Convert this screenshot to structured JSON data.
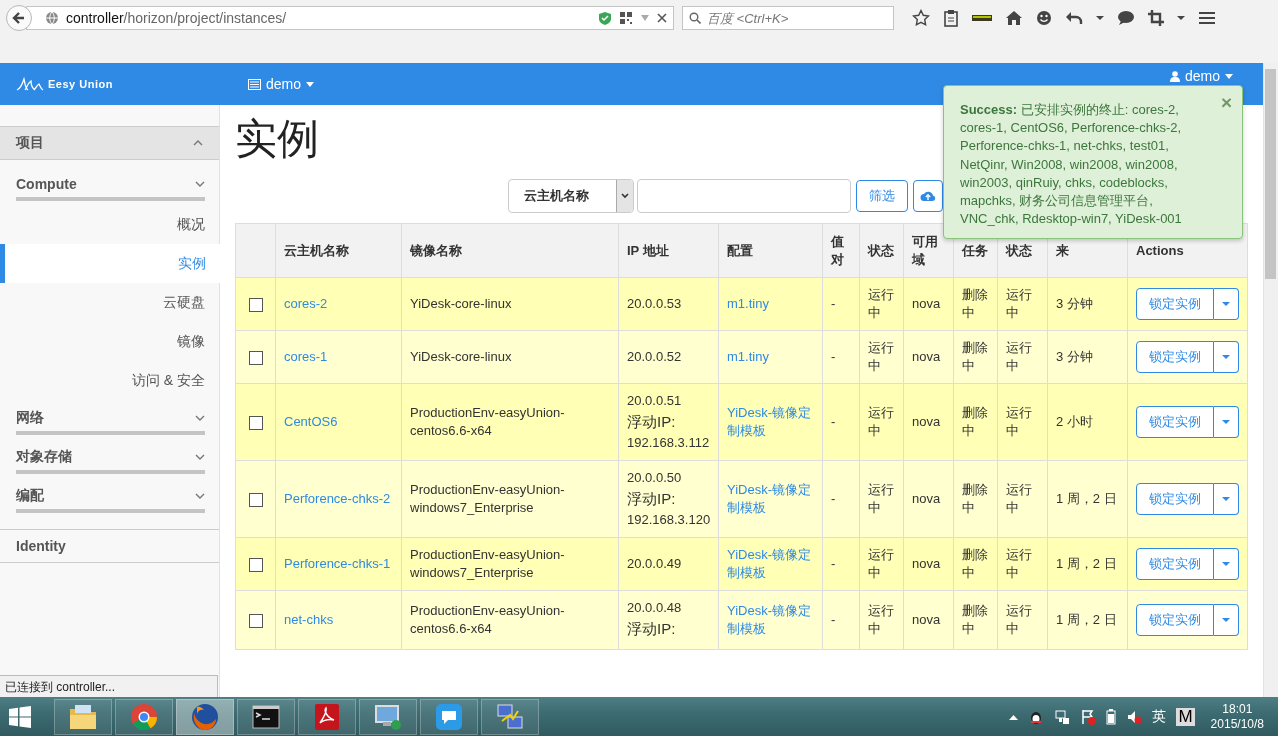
{
  "browser": {
    "url_host": "controller",
    "url_path": "/horizon/project/instances/",
    "search_placeholder": "百度 <Ctrl+K>"
  },
  "navbar": {
    "brand": "Eesy Union",
    "project": "demo",
    "user": "demo"
  },
  "sidebar": [
    {
      "label": "项目",
      "expanded": true,
      "children": [
        {
          "label": "Compute",
          "children": [
            {
              "label": "概况",
              "selected": false
            },
            {
              "label": "实例",
              "selected": true
            },
            {
              "label": "云硬盘",
              "selected": false
            },
            {
              "label": "镜像",
              "selected": false
            },
            {
              "label": "访问 & 安全",
              "selected": false
            }
          ]
        },
        {
          "label": "网络"
        },
        {
          "label": "对象存储"
        },
        {
          "label": "编配"
        }
      ]
    },
    {
      "label": "Identity",
      "expanded": false
    }
  ],
  "page_title": "实例",
  "filter": {
    "field": "云主机名称",
    "button": "筛选"
  },
  "table": {
    "columns": [
      "云主机名称",
      "镜像名称",
      "IP 地址",
      "配置",
      "值对",
      "状态",
      "可用域",
      "任务",
      "状态",
      "来",
      "Actions"
    ],
    "rows": [
      {
        "checked": false,
        "name": "cores-2",
        "image": "YiDesk-core-linux",
        "ip": "20.0.0.53",
        "config": "m1.tiny",
        "keypair": "-",
        "status": "运行中",
        "zone": "nova",
        "task": "删除中",
        "power": "运行中",
        "age": "3 分钟",
        "action": "锁定实例"
      },
      {
        "checked": false,
        "name": "cores-1",
        "image": "YiDesk-core-linux",
        "ip": "20.0.0.52",
        "config": "m1.tiny",
        "keypair": "-",
        "status": "运行中",
        "zone": "nova",
        "task": "删除中",
        "power": "运行中",
        "age": "3 分钟",
        "action": "锁定实例"
      },
      {
        "checked": false,
        "name": "CentOS6",
        "image": "ProductionEnv-easyUnion-centos6.6-x64",
        "ip": "20.0.0.51",
        "floating_label": "浮动IP:",
        "floating_ip": "192.168.3.112",
        "config": "YiDesk-镜像定制模板",
        "keypair": "-",
        "status": "运行中",
        "zone": "nova",
        "task": "删除中",
        "power": "运行中",
        "age": "2 小时",
        "action": "锁定实例"
      },
      {
        "checked": false,
        "name": "Perforence-chks-2",
        "image": "ProductionEnv-easyUnion-windows7_Enterprise",
        "ip": "20.0.0.50",
        "floating_label": "浮动IP:",
        "floating_ip": "192.168.3.120",
        "config": "YiDesk-镜像定制模板",
        "keypair": "-",
        "status": "运行中",
        "zone": "nova",
        "task": "删除中",
        "power": "运行中",
        "age": "1 周，2 日",
        "action": "锁定实例"
      },
      {
        "checked": false,
        "name": "Perforence-chks-1",
        "image": "ProductionEnv-easyUnion-windows7_Enterprise",
        "ip": "20.0.0.49",
        "config": "YiDesk-镜像定制模板",
        "keypair": "-",
        "status": "运行中",
        "zone": "nova",
        "task": "删除中",
        "power": "运行中",
        "age": "1 周，2 日",
        "action": "锁定实例"
      },
      {
        "checked": false,
        "name": "net-chks",
        "image": "ProductionEnv-easyUnion-centos6.6-x64",
        "ip": "20.0.0.48",
        "floating_label": "浮动IP:",
        "config": "YiDesk-镜像定制模板",
        "keypair": "-",
        "status": "运行中",
        "zone": "nova",
        "task": "删除中",
        "power": "运行中",
        "age": "1 周，2 日",
        "action": "锁定实例"
      }
    ]
  },
  "toast": {
    "message": "**Success:** 已安排实例的终止: cores-2, cores-1, CentOS6, Perforence-chks-2, Perforence-chks-1, net-chks, test01, NetQinr, Win2008, win2008, win2008, win2003, qinRuiy, chks, codeblocks, mapchks, 财务公司信息管理平台, VNC_chk, Rdesktop-win7, YiDesk-001",
    "close": "×"
  },
  "status_tooltip": "已连接到 controller...",
  "taskbar": {
    "apps": [
      {
        "kind": "folder",
        "selected": false
      },
      {
        "kind": "chrome",
        "selected": false
      },
      {
        "kind": "firefox",
        "selected": true
      },
      {
        "kind": "terminal",
        "selected": false
      },
      {
        "kind": "pdf",
        "selected": false
      },
      {
        "kind": "remote",
        "selected": false
      },
      {
        "kind": "chat",
        "selected": false
      },
      {
        "kind": "network",
        "selected": false
      }
    ],
    "ime": "英",
    "keyboard": "M",
    "time": "18:01",
    "date": "2015/10/8"
  }
}
